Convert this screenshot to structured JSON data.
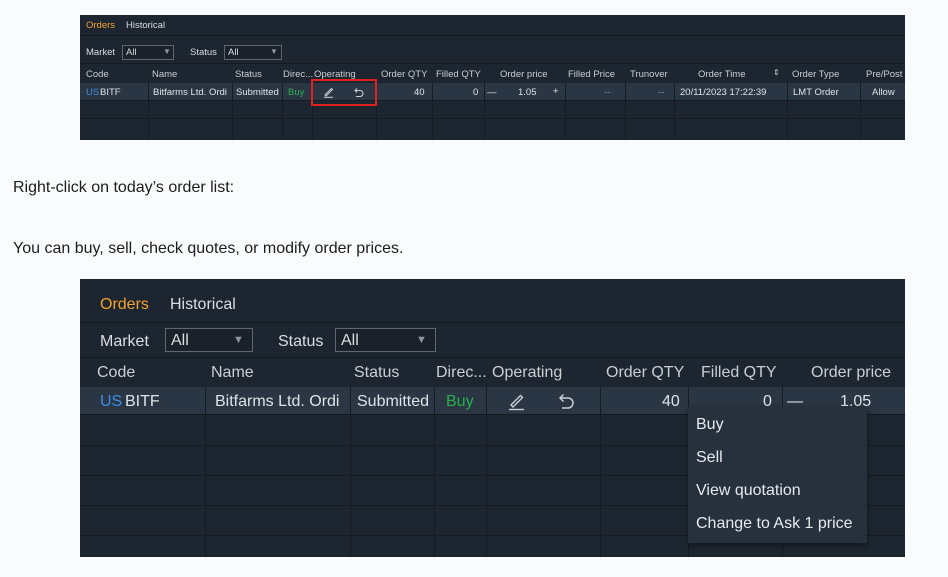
{
  "top_panel": {
    "tabs": [
      "Orders",
      "Historical"
    ],
    "filters": {
      "market_label": "Market",
      "market_value": "All",
      "status_label": "Status",
      "status_value": "All"
    },
    "columns": [
      "Code",
      "Name",
      "Status",
      "Direc...",
      "Operating",
      "Order QTY",
      "Filled QTY",
      "Order price",
      "Filled Price",
      "Trunover",
      "Order Time",
      "Order Type",
      "Pre/Post"
    ],
    "sort_icon": "sort-arrows-icon",
    "row": {
      "market": "US",
      "code": "BITF",
      "name": "Bitfarms Ltd. Ordi",
      "status": "Submitted",
      "direction": "Buy",
      "order_qty": "40",
      "filled_qty": "0",
      "minus": "—",
      "order_price": "1.05",
      "plus": "+",
      "filled_price": "--",
      "turnover": "--",
      "order_time": "20/11/2023 17:22:39",
      "order_type": "LMT Order",
      "pre_post": "Allow"
    }
  },
  "instructions": {
    "line1": "Right-click on today’s order list:",
    "line2": "You can buy, sell, check quotes, or modify order prices."
  },
  "bottom_panel": {
    "tabs": [
      "Orders",
      "Historical"
    ],
    "filters": {
      "market_label": "Market",
      "market_value": "All",
      "status_label": "Status",
      "status_value": "All"
    },
    "columns": [
      "Code",
      "Name",
      "Status",
      "Direc...",
      "Operating",
      "Order QTY",
      "Filled QTY",
      "Order price"
    ],
    "row": {
      "market": "US",
      "code": "BITF",
      "name": "Bitfarms Ltd. Ordi",
      "status": "Submitted",
      "direction": "Buy",
      "order_qty": "40",
      "filled_qty": "0",
      "minus": "—",
      "order_price": "1.05"
    },
    "context_menu": [
      "Buy",
      "Sell",
      "View quotation",
      "Change to Ask 1 price"
    ]
  },
  "icons": {
    "edit": "pencil-icon",
    "undo": "undo-arrow-icon",
    "dropdown": "caret-down-icon"
  },
  "colors": {
    "active_tab": "#f3a32d",
    "buy": "#2bb04b",
    "market_tag": "#3b8ee6",
    "highlight": "#e0201f",
    "panel_bg": "#1d2630"
  }
}
